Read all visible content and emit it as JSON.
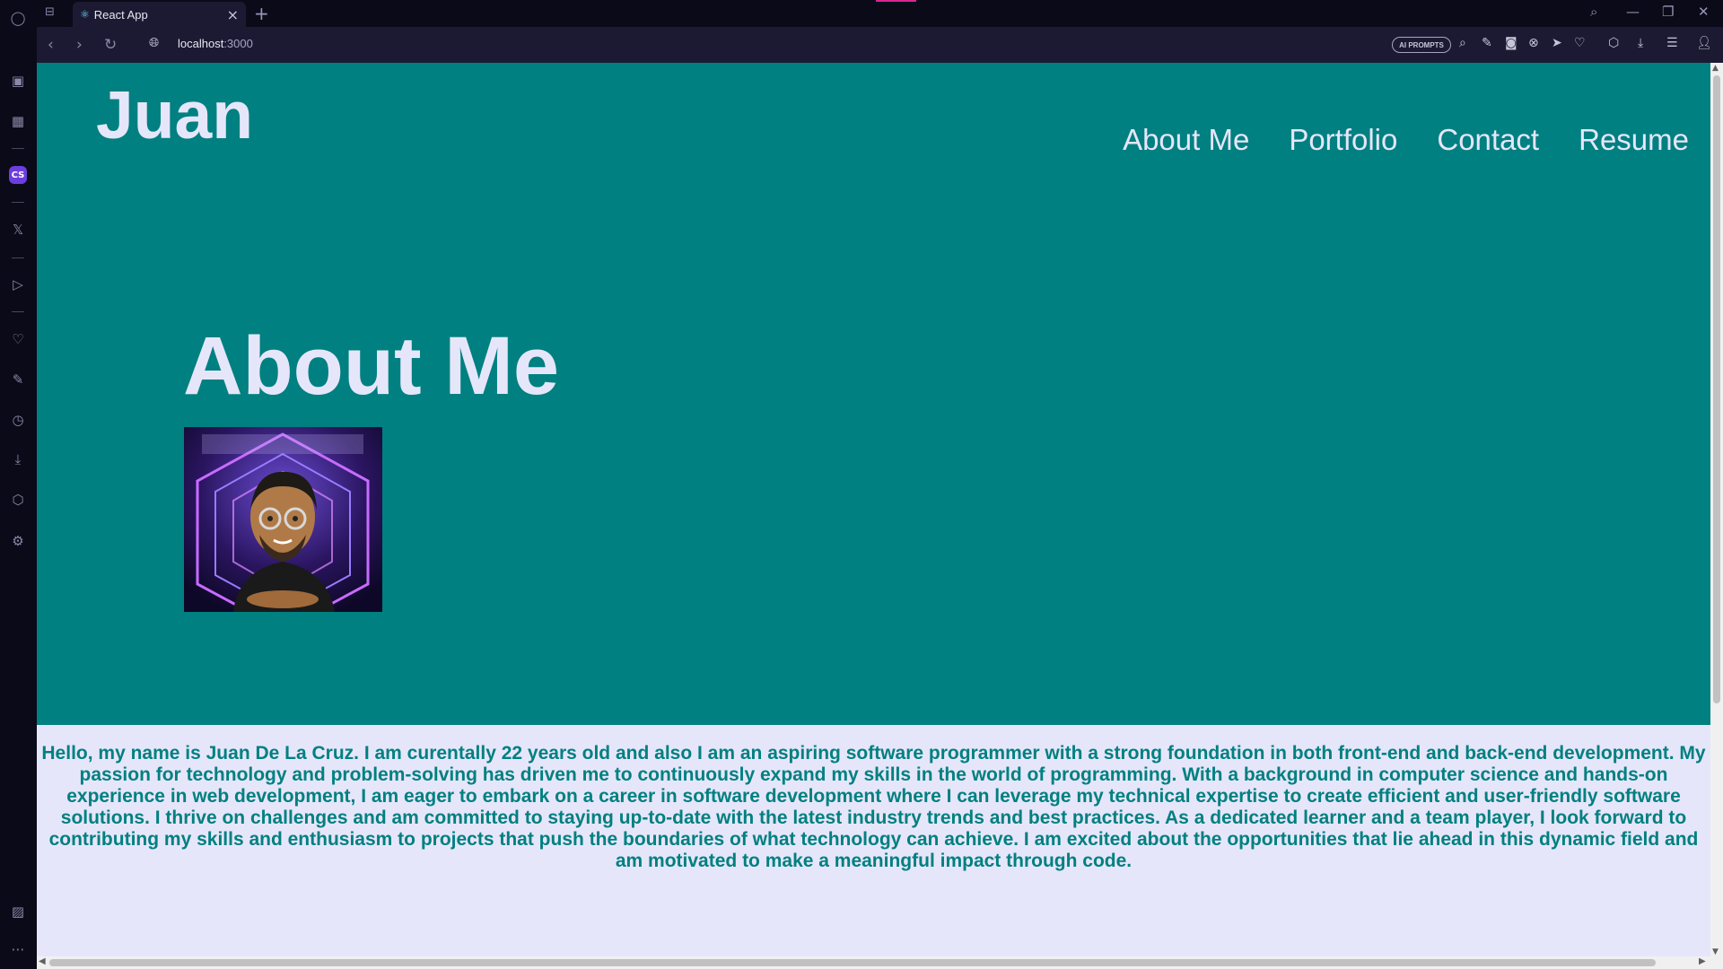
{
  "browser": {
    "tab_title": "React App",
    "tab_favicon": "react-icon",
    "url_host": "localhost",
    "url_port": ":3000",
    "ai_prompts_label": "AI PROMPTS"
  },
  "site": {
    "logo": "Juan",
    "nav": [
      "About Me",
      "Portfolio",
      "Contact",
      "Resume"
    ],
    "section_title": "About Me",
    "bio": "Hello, my name is Juan De La Cruz. I am curentally 22 years old and also I am an aspiring software programmer with a strong foundation in both front-end and back-end development. My passion for technology and problem-solving has driven me to continuously expand my skills in the world of programming. With a background in computer science and hands-on experience in web development, I am eager to embark on a career in software development where I can leverage my technical expertise to create efficient and user-friendly software solutions. I thrive on challenges and am committed to staying up-to-date with the latest industry trends and best practices. As a dedicated learner and a team player, I look forward to contributing my skills and enthusiasm to projects that push the boundaries of what technology can achieve. I am excited about the opportunities that lie ahead in this dynamic field and am motivated to make a meaningful impact through code.",
    "colors": {
      "primary": "#008080",
      "light": "#e6e6fa"
    }
  }
}
